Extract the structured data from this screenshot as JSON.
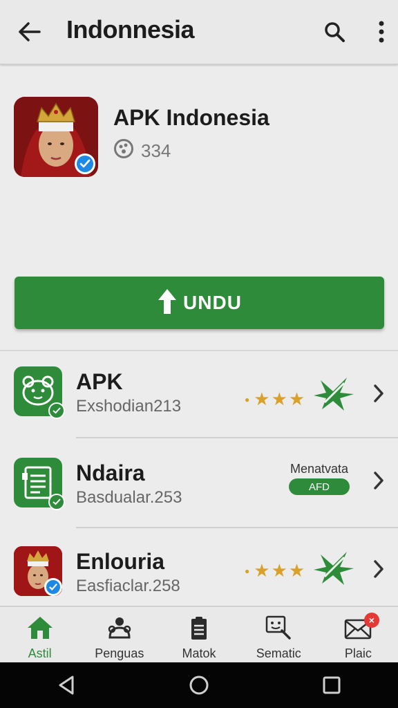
{
  "appbar": {
    "title": "Indonnesia"
  },
  "header": {
    "app_name": "APK Indonesia",
    "count": "334"
  },
  "download": {
    "label": "UNDU"
  },
  "list": [
    {
      "name": "APK",
      "sub": "Exshodian213",
      "rating_stars": 3
    },
    {
      "name": "Ndaira",
      "sub": "Basdualar.253",
      "right_text": "Menatvata",
      "pill": "AFD"
    },
    {
      "name": "Enlouria",
      "sub": "Easfiaclar.258",
      "rating_stars": 3
    }
  ],
  "bottomnav": {
    "tabs": [
      {
        "label": "Astil",
        "icon": "home-icon",
        "active": true
      },
      {
        "label": "Penguas",
        "icon": "people-icon"
      },
      {
        "label": "Matok",
        "icon": "clipboard-icon"
      },
      {
        "label": "Sematic",
        "icon": "search-face-icon"
      },
      {
        "label": "Plaic",
        "icon": "mail-icon",
        "badge": "×"
      }
    ]
  },
  "colors": {
    "brand_green": "#2e8b3a",
    "star": "#d9a02a",
    "verify_blue": "#1e88e5",
    "badge_red": "#e53935"
  }
}
